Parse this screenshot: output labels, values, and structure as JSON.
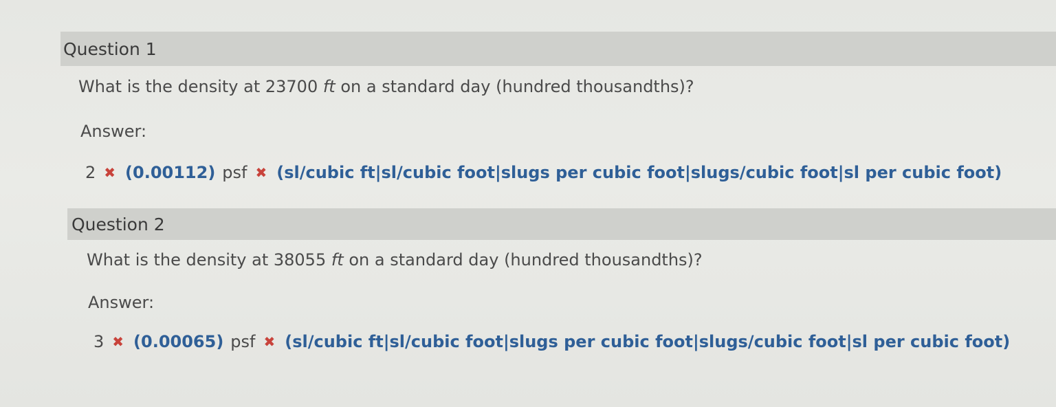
{
  "questions": [
    {
      "title": "Question 1",
      "text_before": "What is the density at 23700 ",
      "text_unit": "ft",
      "text_after": " on a standard day (hundred thousandths)?",
      "answer_label": "Answer:",
      "given_answer": "2",
      "correct_value": "(0.00112)",
      "given_unit": "psf",
      "correct_unit": "(sl/cubic ft|sl/cubic foot|slugs per cubic foot|slugs/cubic foot|sl per cubic foot)"
    },
    {
      "title": "Question 2",
      "text_before": "What is the density at 38055 ",
      "text_unit": "ft",
      "text_after": " on a standard day (hundred thousandths)?",
      "answer_label": "Answer:",
      "given_answer": "3",
      "correct_value": "(0.00065)",
      "given_unit": "psf",
      "correct_unit": "(sl/cubic ft|sl/cubic foot|slugs per cubic foot|slugs/cubic foot|sl per cubic foot)"
    }
  ],
  "icons": {
    "incorrect": "✖"
  },
  "colors": {
    "header_bg": "#cfd0cc",
    "incorrect": "#c8433b",
    "correct_answer": "#2f5f97"
  }
}
